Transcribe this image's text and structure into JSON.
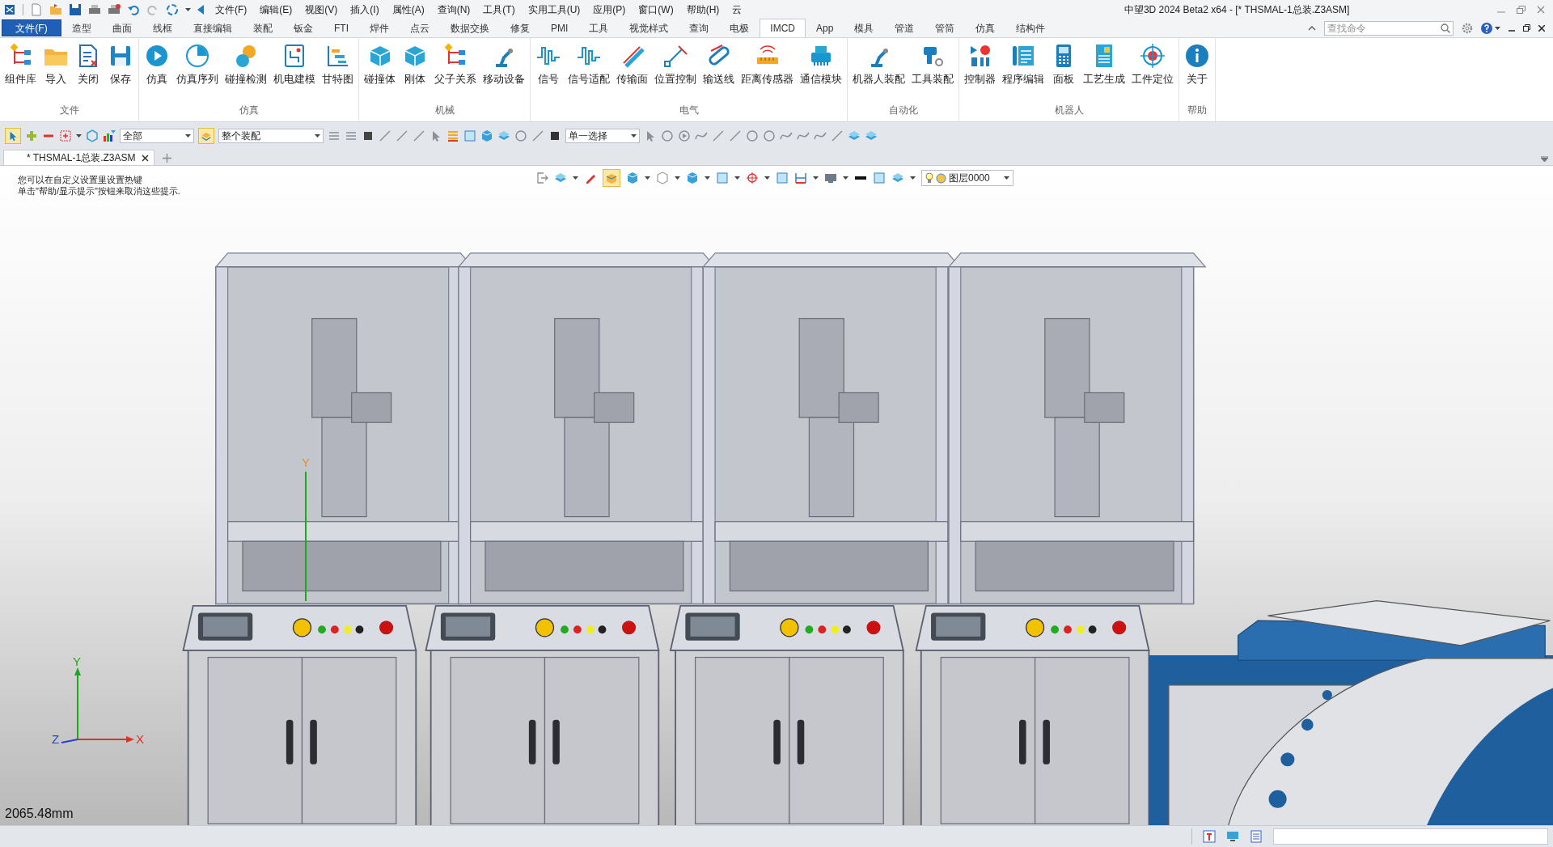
{
  "title_bar": {
    "menus": [
      "文件(F)",
      "编辑(E)",
      "视图(V)",
      "插入(I)",
      "属性(A)",
      "查询(N)",
      "工具(T)",
      "实用工具(U)",
      "应用(P)",
      "窗口(W)",
      "帮助(H)",
      "云"
    ],
    "title": "中望3D 2024 Beta2 x64 - [* THSMAL-1总装.Z3ASM]"
  },
  "file_button": "文件(F)",
  "ribbon_tabs": [
    {
      "label": "造型",
      "selected": false
    },
    {
      "label": "曲面",
      "selected": false
    },
    {
      "label": "线框",
      "selected": false
    },
    {
      "label": "直接编辑",
      "selected": false
    },
    {
      "label": "装配",
      "selected": false
    },
    {
      "label": "钣金",
      "selected": false
    },
    {
      "label": "FTI",
      "selected": false
    },
    {
      "label": "焊件",
      "selected": false
    },
    {
      "label": "点云",
      "selected": false
    },
    {
      "label": "数据交换",
      "selected": false
    },
    {
      "label": "修复",
      "selected": false
    },
    {
      "label": "PMI",
      "selected": false
    },
    {
      "label": "工具",
      "selected": false
    },
    {
      "label": "视觉样式",
      "selected": false
    },
    {
      "label": "查询",
      "selected": false
    },
    {
      "label": "电极",
      "selected": false
    },
    {
      "label": "IMCD",
      "selected": true
    },
    {
      "label": "App",
      "selected": false
    },
    {
      "label": "模具",
      "selected": false
    },
    {
      "label": "管道",
      "selected": false
    },
    {
      "label": "管筒",
      "selected": false
    },
    {
      "label": "仿真",
      "selected": false
    },
    {
      "label": "结构件",
      "selected": false
    }
  ],
  "search": {
    "placeholder": "查找命令"
  },
  "ribbon_groups": [
    {
      "label": "文件",
      "items": [
        "组件库",
        "导入",
        "关闭",
        "保存"
      ]
    },
    {
      "label": "仿真",
      "items": [
        "仿真",
        "仿真序列",
        "碰撞检测",
        "机电建模",
        "甘特图"
      ]
    },
    {
      "label": "机械",
      "items": [
        "碰撞体",
        "刚体",
        "父子关系",
        "移动设备"
      ]
    },
    {
      "label": "电气",
      "items": [
        "信号",
        "信号适配",
        "传输面",
        "位置控制",
        "输送线",
        "距离传感器",
        "通信模块"
      ]
    },
    {
      "label": "自动化",
      "items": [
        "机器人装配",
        "工具装配"
      ]
    },
    {
      "label": "机器人",
      "items": [
        "控制器",
        "程序编辑",
        "面板",
        "工艺生成",
        "工件定位"
      ]
    },
    {
      "label": "帮助",
      "items": [
        "关于"
      ]
    }
  ],
  "toolbar": {
    "filter": "全部",
    "scope": "整个装配",
    "select_mode": "单一选择",
    "pick_active": true
  },
  "doc_tabs": [
    {
      "label": "* THSMAL-1总装.Z3ASM",
      "selected": true
    }
  ],
  "hints": [
    "您可以在自定义设置里设置热键",
    "单击\"帮助/显示提示\"按钮来取消这些提示."
  ],
  "view_toolbar": {
    "layer": "图层0000",
    "shaded_active": true
  },
  "viewport": {
    "axis_labels": [
      "X",
      "Y",
      "Z"
    ],
    "model_axis_label": "Y",
    "scale": "2065.48mm"
  }
}
